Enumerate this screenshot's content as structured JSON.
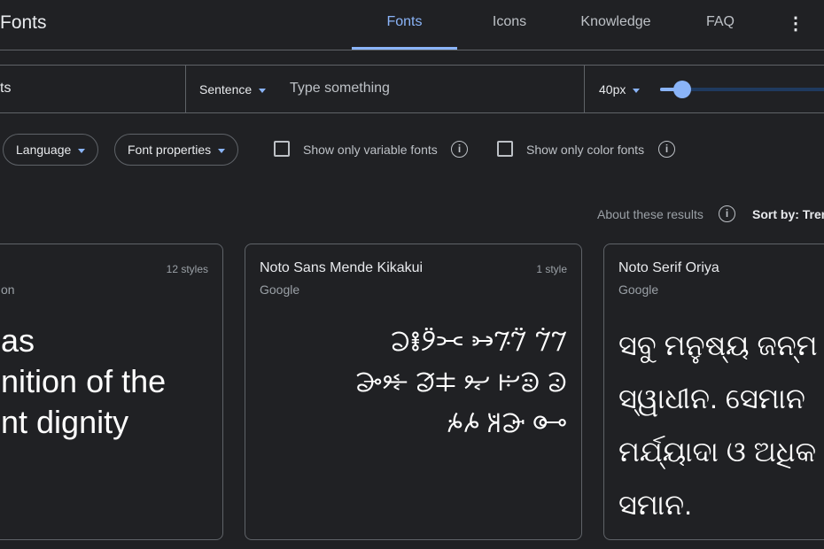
{
  "header": {
    "title": "Fonts",
    "tabs": [
      {
        "label": "Fonts",
        "active": true
      },
      {
        "label": "Icons"
      },
      {
        "label": "Knowledge"
      },
      {
        "label": "FAQ"
      }
    ],
    "more_icon": "more-vert-icon"
  },
  "toolbar": {
    "search_value": "ts",
    "preview_mode": "Sentence",
    "preview_placeholder": "Type something",
    "size": "40px",
    "size_slider_value": 40
  },
  "filters": {
    "language": "Language",
    "font_properties": "Font properties",
    "variable_label": "Show only variable fonts",
    "color_label": "Show only color fonts"
  },
  "results": {
    "about": "About these results",
    "sort": "Sort by: Tren"
  },
  "cards": [
    {
      "name": "",
      "author": "on",
      "styles": "12 styles",
      "sample": [
        "as",
        "nition of the",
        "nt dignity"
      ]
    },
    {
      "name": "Noto Sans Mende Kikakui",
      "author": "Google",
      "styles": "1 style",
      "sample": [
        "𞠀𞠁 𞠂𞠃𞠄 𞠅𞠆𞠇𞠈",
        "𞠉 𞠊𞠋 𞠌 𞠍𞠎 𞠏𞠐",
        "𞠑 𞠒𞠓 𞠔𞠕"
      ]
    },
    {
      "name": "Noto Serif Oriya",
      "author": "Google",
      "styles": "",
      "sample": [
        "ସବୁ ମନୁଷ୍ୟ ଜନ୍ମ",
        "ସ୍ୱାଧୀନ. ସେମାନ",
        "ମର୍ଯ୍ୟାଦା ଓ ଅଧିକ",
        "ସମାନ."
      ]
    }
  ],
  "colors": {
    "accent": "#8ab4f8",
    "background": "#202124",
    "border": "#5f6368"
  }
}
